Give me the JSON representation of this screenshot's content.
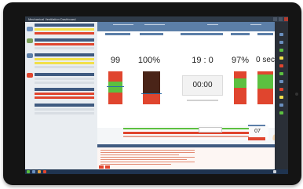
{
  "window": {
    "title": "Mechanical Ventilation Dashboard"
  },
  "metrics": [
    {
      "id": "m1",
      "value": "99"
    },
    {
      "id": "m2",
      "value": "100%"
    },
    {
      "id": "m3",
      "value": "19 : 0"
    },
    {
      "id": "m4",
      "value": "97%"
    },
    {
      "id": "m5",
      "value": "0 sec"
    }
  ],
  "timer": {
    "value": "00:00"
  },
  "counter": {
    "value": "07"
  },
  "colors": {
    "accent": "#5c7fa8",
    "alarm_red": "#e0452e",
    "normal_green": "#5cc040",
    "warning_yellow": "#f1e04a",
    "dark_panel": "#4a2418"
  },
  "icons": [
    "lungs-icon",
    "hospital-icon",
    "close-icon",
    "minimize-icon"
  ]
}
